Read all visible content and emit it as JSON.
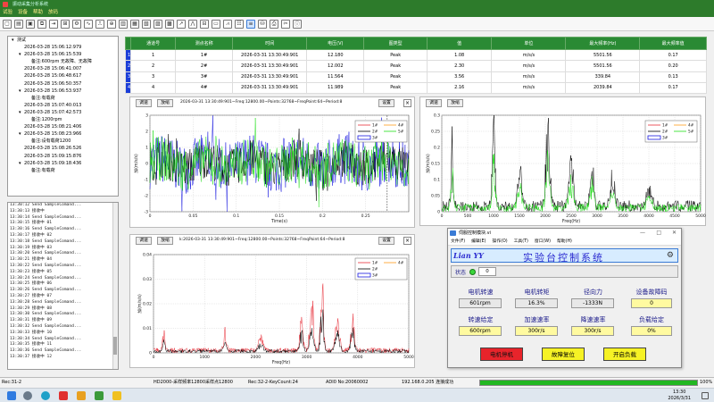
{
  "window": {
    "title": "振动采集分析系统"
  },
  "menu": [
    "试验",
    "设备",
    "帮助",
    "放码"
  ],
  "tree": [
    {
      "label": "测试",
      "indent": 0,
      "arrow": "▾"
    },
    {
      "label": "2026-03-28 15:06:12:979",
      "indent": 1,
      "arrow": ""
    },
    {
      "label": "2026-03-28 15:06:15:539",
      "indent": 1,
      "arrow": "▾"
    },
    {
      "label": "备注:600rpm 无故障、无故障",
      "indent": 2,
      "arrow": ""
    },
    {
      "label": "2026-03-28 15:06:41:007",
      "indent": 1,
      "arrow": ""
    },
    {
      "label": "2026-03-28 15:06:48:617",
      "indent": 1,
      "arrow": ""
    },
    {
      "label": "2026-03-28 15:06:50:357",
      "indent": 1,
      "arrow": ""
    },
    {
      "label": "2026-03-28 15:06:53:937",
      "indent": 1,
      "arrow": "▾"
    },
    {
      "label": "备注:有载荷",
      "indent": 2,
      "arrow": ""
    },
    {
      "label": "2026-03-28 15:07:40:013",
      "indent": 1,
      "arrow": ""
    },
    {
      "label": "2026-03-28 15:07:42:573",
      "indent": 1,
      "arrow": "▾"
    },
    {
      "label": "备注:1200rpm",
      "indent": 2,
      "arrow": ""
    },
    {
      "label": "2026-03-28 15:08:21:406",
      "indent": 1,
      "arrow": ""
    },
    {
      "label": "2026-03-28 15:08:23:966",
      "indent": 1,
      "arrow": "▾"
    },
    {
      "label": "备注:设有载荷1200",
      "indent": 2,
      "arrow": ""
    },
    {
      "label": "2026-03-28 15:08:26:526",
      "indent": 1,
      "arrow": ""
    },
    {
      "label": "2026-03-28 15:09:15:876",
      "indent": 1,
      "arrow": ""
    },
    {
      "label": "2026-03-28 15:09:18:436",
      "indent": 1,
      "arrow": "▾"
    },
    {
      "label": "备注:有载荷",
      "indent": 2,
      "arrow": ""
    }
  ],
  "log": [
    "13:30:12 Send SampleComand...",
    "13:30:13 接收中",
    "13:30:14 Send SampleComand...",
    "13:30:15 接收中 01",
    "13:30:16 Send SampleComand...",
    "13:30:17 接收中 02",
    "13:30:18 Send SampleComand...",
    "13:30:19 接收中 03",
    "13:30:20 Send SampleComand...",
    "13:30:21 接收中 04",
    "13:30:22 Send SampleComand...",
    "13:30:23 接收中 05",
    "13:30:24 Send SampleComand...",
    "13:30:25 接收中 06",
    "13:30:26 Send SampleComand...",
    "13:30:27 接收中 07",
    "13:30:28 Send SampleComand...",
    "13:30:29 接收中 08",
    "13:30:30 Send SampleComand...",
    "13:30:31 接收中 09",
    "13:30:32 Send SampleComand...",
    "13:30:33 接收中 10",
    "13:30:34 Send SampleComand...",
    "13:30:35 接收中 11",
    "13:30:36 Send SampleComand...",
    "13:30:37 接收中 12"
  ],
  "table": {
    "headers": [
      "通道号",
      "测点名称",
      "时间",
      "电压(V)",
      "图类型",
      "值",
      "单位",
      "最大频率(Hz)",
      "最大频率值"
    ],
    "rows": [
      {
        "n": "1",
        "ch": "1",
        "name": "1#",
        "time": "2026-03-31 13:30:49:901",
        "v": "12.180",
        "type": "Peak",
        "val": "1.08",
        "unit": "m/s/s",
        "fmax": "5501.56",
        "fval": "0.17"
      },
      {
        "n": "2",
        "ch": "2",
        "name": "2#",
        "time": "2026-03-31 13:30:49:901",
        "v": "12.002",
        "type": "Peak",
        "val": "2.30",
        "unit": "m/s/s",
        "fmax": "5501.56",
        "fval": "0.20"
      },
      {
        "n": "3",
        "ch": "3",
        "name": "3#",
        "time": "2026-03-31 13:30:49:901",
        "v": "11.564",
        "type": "Peak",
        "val": "3.56",
        "unit": "m/s/s",
        "fmax": "339.84",
        "fval": "0.13"
      },
      {
        "n": "4",
        "ch": "4",
        "name": "4#",
        "time": "2026-03-31 13:30:49:901",
        "v": "11.989",
        "type": "Peak",
        "val": "2.16",
        "unit": "m/s/s",
        "fmax": "2039.84",
        "fval": "0.17"
      }
    ]
  },
  "charts": {
    "btn_adjust": "调速",
    "btn_zoom": "放缩",
    "btn_settings": "设置",
    "close": "×",
    "info": "2026-03-31 13:30:49:901~Freq:12800.00~Points:32768~FreqPoint:64~Period:8",
    "info_short": "k:2026-03-31 13:30:49:901~Freq:12800.00~Points:32768~FreqPoint:64~Period:8"
  },
  "chart_data": [
    {
      "type": "line",
      "xlabel": "Time(s)",
      "ylabel": "加(m/s/s)",
      "xlim": [
        0,
        0.3
      ],
      "ylim": [
        -3,
        3
      ],
      "x_ticks": [
        0,
        0.05,
        0.1,
        0.15,
        0.2,
        0.25
      ],
      "y_ticks": [
        3,
        2,
        1,
        0,
        -1,
        -2,
        -3
      ],
      "legend": [
        "1#",
        "2#",
        "3#",
        "4#",
        "5#"
      ],
      "series_colors": [
        "#e8303a",
        "#000000",
        "#1a1ae0",
        "#ff9c1a",
        "#21e01a"
      ]
    },
    {
      "type": "line",
      "xlabel": "Freq(Hz)",
      "ylabel": "加(m/s/s)",
      "xlim": [
        0,
        5000
      ],
      "ylim": [
        0,
        0.3
      ],
      "x_ticks": [
        0,
        500,
        1000,
        1500,
        2000,
        2500,
        3000,
        3500,
        4000,
        4500,
        5000
      ],
      "y_ticks": [
        0.3,
        0.25,
        0.2,
        0.15,
        0.1,
        0.05,
        0
      ],
      "legend": [
        "1#",
        "2#",
        "3#",
        "4#",
        "5#"
      ]
    },
    {
      "type": "line",
      "xlabel": "Freq(Hz)",
      "ylabel": "加(m/s/s)",
      "xlim": [
        0,
        5000
      ],
      "ylim": [
        0,
        0.04
      ],
      "x_ticks": [
        0,
        1000,
        2000,
        3000,
        4000,
        5000
      ],
      "y_ticks": [
        0.04,
        0.03,
        0.02,
        0.01,
        0
      ],
      "legend": [
        "1#",
        "2#",
        "3#",
        "4#"
      ]
    }
  ],
  "control": {
    "title": "伺服控制模块.vi",
    "menu": [
      "文件(F)",
      "编辑(E)",
      "操作(O)",
      "工具(T)",
      "窗口(W)",
      "帮助(H)"
    ],
    "logo": "Lian YY",
    "heading": "实验台控制系统",
    "status_label": "状态",
    "status_value": "0",
    "labels": {
      "speed": "电机转速",
      "torque": "电机转矩",
      "radial": "径向力",
      "fault": "设备故障码",
      "speed_set": "转速给定",
      "acc": "加速速率",
      "dec": "降速速率",
      "load": "负载给定"
    },
    "values": {
      "speed": "601rpm",
      "torque": "16.3%",
      "radial": "-1333N",
      "fault": "0",
      "speed_set": "600rpm",
      "acc": "300r/s",
      "dec": "300r/s",
      "load": "0%"
    },
    "buttons": {
      "stop": "电机停机",
      "reset": "故障复位",
      "load": "开启负载"
    },
    "colors": {
      "stop": "#e8242b",
      "reset": "#f6f225",
      "load": "#f6f225",
      "input": "#fffaa0",
      "banner": "#d7ecff",
      "accent": "#2b2bd0"
    }
  },
  "statusbar": {
    "rec": "Rec:31-2",
    "freq": "HD2000-采样频率12800采样点12800",
    "key": "Rec:32-2-KeyCount:24",
    "addr": "ADI0 No:20060002",
    "ip": "192.168.0.205 连接成功",
    "progress_pct": "100%",
    "progress": 1.0
  },
  "taskbar": {
    "time": "13:30",
    "date": "2026/3/31"
  }
}
